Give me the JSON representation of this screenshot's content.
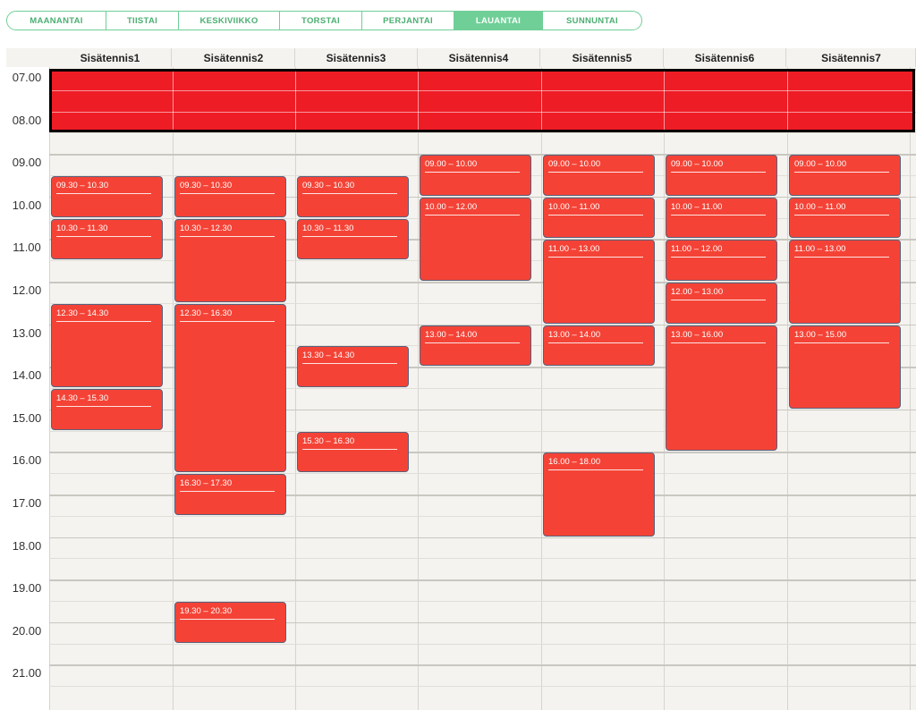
{
  "days": [
    {
      "label": "MAANANTAI",
      "active": false
    },
    {
      "label": "TIISTAI",
      "active": false
    },
    {
      "label": "KESKIVIIKKO",
      "active": false
    },
    {
      "label": "TORSTAI",
      "active": false
    },
    {
      "label": "PERJANTAI",
      "active": false
    },
    {
      "label": "LAUANTAI",
      "active": true
    },
    {
      "label": "SUNNUNTAI",
      "active": false
    }
  ],
  "courts": [
    "Sisätennis1",
    "Sisätennis2",
    "Sisätennis3",
    "Sisätennis4",
    "Sisätennis5",
    "Sisätennis6",
    "Sisätennis7"
  ],
  "hours": [
    "07.00",
    "08.00",
    "09.00",
    "10.00",
    "11.00",
    "12.00",
    "13.00",
    "14.00",
    "15.00",
    "16.00",
    "17.00",
    "18.00",
    "19.00",
    "20.00",
    "21.00"
  ],
  "blocked": {
    "start": 7.0,
    "end": 8.5
  },
  "colors": {
    "booking": "#f44336",
    "blocked": "#ee1c25",
    "tab_accent": "#6fcf97"
  },
  "bookings": [
    {
      "court": 0,
      "start": 9.5,
      "end": 10.5,
      "label": "09.30 – 10.30"
    },
    {
      "court": 0,
      "start": 10.5,
      "end": 11.5,
      "label": "10.30 – 11.30"
    },
    {
      "court": 0,
      "start": 12.5,
      "end": 14.5,
      "label": "12.30 – 14.30"
    },
    {
      "court": 0,
      "start": 14.5,
      "end": 15.5,
      "label": "14.30 – 15.30"
    },
    {
      "court": 1,
      "start": 9.5,
      "end": 10.5,
      "label": "09.30 – 10.30"
    },
    {
      "court": 1,
      "start": 10.5,
      "end": 12.5,
      "label": "10.30 – 12.30"
    },
    {
      "court": 1,
      "start": 12.5,
      "end": 16.5,
      "label": "12.30 – 16.30"
    },
    {
      "court": 1,
      "start": 16.5,
      "end": 17.5,
      "label": "16.30 – 17.30"
    },
    {
      "court": 1,
      "start": 19.5,
      "end": 20.5,
      "label": "19.30 – 20.30"
    },
    {
      "court": 2,
      "start": 9.5,
      "end": 10.5,
      "label": "09.30 – 10.30"
    },
    {
      "court": 2,
      "start": 10.5,
      "end": 11.5,
      "label": "10.30 – 11.30"
    },
    {
      "court": 2,
      "start": 13.5,
      "end": 14.5,
      "label": "13.30 – 14.30"
    },
    {
      "court": 2,
      "start": 15.5,
      "end": 16.5,
      "label": "15.30 – 16.30"
    },
    {
      "court": 3,
      "start": 9.0,
      "end": 10.0,
      "label": "09.00 – 10.00"
    },
    {
      "court": 3,
      "start": 10.0,
      "end": 12.0,
      "label": "10.00 – 12.00"
    },
    {
      "court": 3,
      "start": 13.0,
      "end": 14.0,
      "label": "13.00 – 14.00"
    },
    {
      "court": 4,
      "start": 9.0,
      "end": 10.0,
      "label": "09.00 – 10.00"
    },
    {
      "court": 4,
      "start": 10.0,
      "end": 11.0,
      "label": "10.00 – 11.00"
    },
    {
      "court": 4,
      "start": 11.0,
      "end": 13.0,
      "label": "11.00 – 13.00"
    },
    {
      "court": 4,
      "start": 13.0,
      "end": 14.0,
      "label": "13.00 – 14.00"
    },
    {
      "court": 4,
      "start": 16.0,
      "end": 18.0,
      "label": "16.00 – 18.00"
    },
    {
      "court": 5,
      "start": 9.0,
      "end": 10.0,
      "label": "09.00 – 10.00"
    },
    {
      "court": 5,
      "start": 10.0,
      "end": 11.0,
      "label": "10.00 – 11.00"
    },
    {
      "court": 5,
      "start": 11.0,
      "end": 12.0,
      "label": "11.00 – 12.00"
    },
    {
      "court": 5,
      "start": 12.0,
      "end": 13.0,
      "label": "12.00 – 13.00"
    },
    {
      "court": 5,
      "start": 13.0,
      "end": 16.0,
      "label": "13.00 – 16.00"
    },
    {
      "court": 6,
      "start": 9.0,
      "end": 10.0,
      "label": "09.00 – 10.00"
    },
    {
      "court": 6,
      "start": 10.0,
      "end": 11.0,
      "label": "10.00 – 11.00"
    },
    {
      "court": 6,
      "start": 11.0,
      "end": 13.0,
      "label": "11.00 – 13.00"
    },
    {
      "court": 6,
      "start": 13.0,
      "end": 15.0,
      "label": "13.00 – 15.00"
    }
  ]
}
